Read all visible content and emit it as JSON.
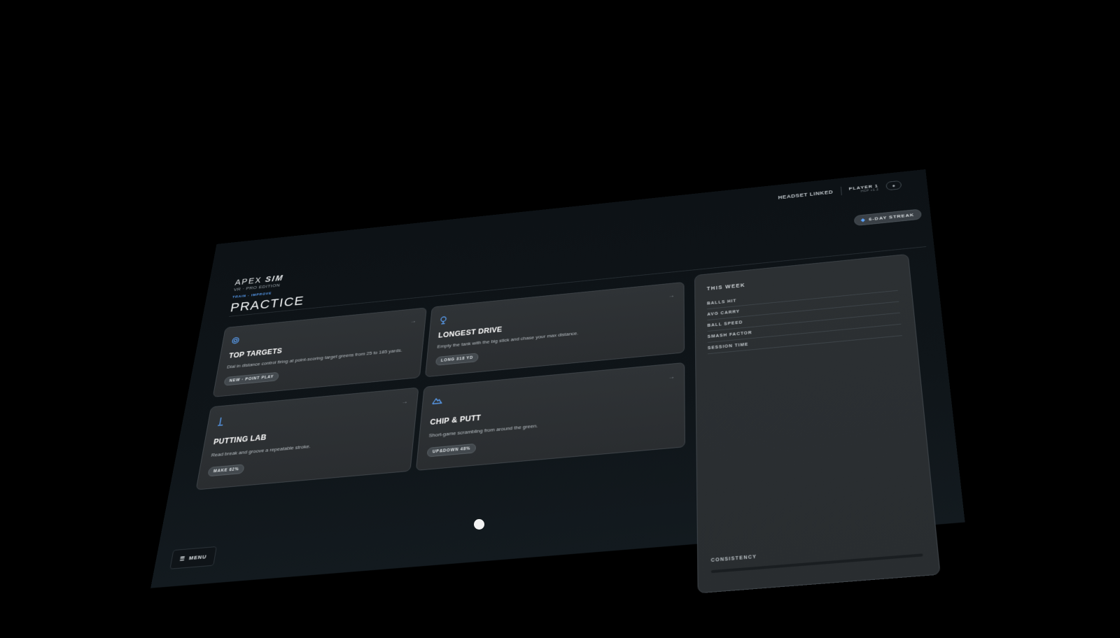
{
  "brand": {
    "name_light": "APEX ",
    "name_bold": "SIM",
    "edition": "VR · PRO EDITION"
  },
  "breadcrumb": "TRAIN · IMPROVE",
  "page_title": "PRACTICE",
  "status": {
    "headset": "HEADSET LINKED",
    "player_name": "PLAYER 1",
    "player_hcp": "HCP +1.2",
    "streak": "6-DAY STREAK"
  },
  "cards": [
    {
      "icon": "target-icon",
      "title": "TOP TARGETS",
      "description": "Dial in distance control firing at point-scoring target greens from 25 to 185 yards.",
      "badge": "NEW · POINT PLAY"
    },
    {
      "icon": "pin-icon",
      "title": "LONGEST DRIVE",
      "description": "Empty the tank with the big stick and chase your max distance.",
      "badge": "LONG 318 YD"
    },
    {
      "icon": "putter-icon",
      "title": "PUTTING LAB",
      "description": "Read break and groove a repeatable stroke.",
      "badge": "MAKE 62%"
    },
    {
      "icon": "terrain-icon",
      "title": "CHIP & PUTT",
      "description": "Short-game scrambling from around the green.",
      "badge": "UP&DOWN 48%"
    }
  ],
  "week": {
    "title": "THIS WEEK",
    "items": [
      "BALLS HIT",
      "AVG CARRY",
      "BALL SPEED",
      "SMASH FACTOR",
      "SESSION TIME"
    ],
    "consistency_label": "CONSISTENCY"
  },
  "menu": {
    "label": "MENU"
  },
  "colors": {
    "accent": "#5da6ff",
    "background": "#0d1216",
    "card": "#2f3336"
  }
}
